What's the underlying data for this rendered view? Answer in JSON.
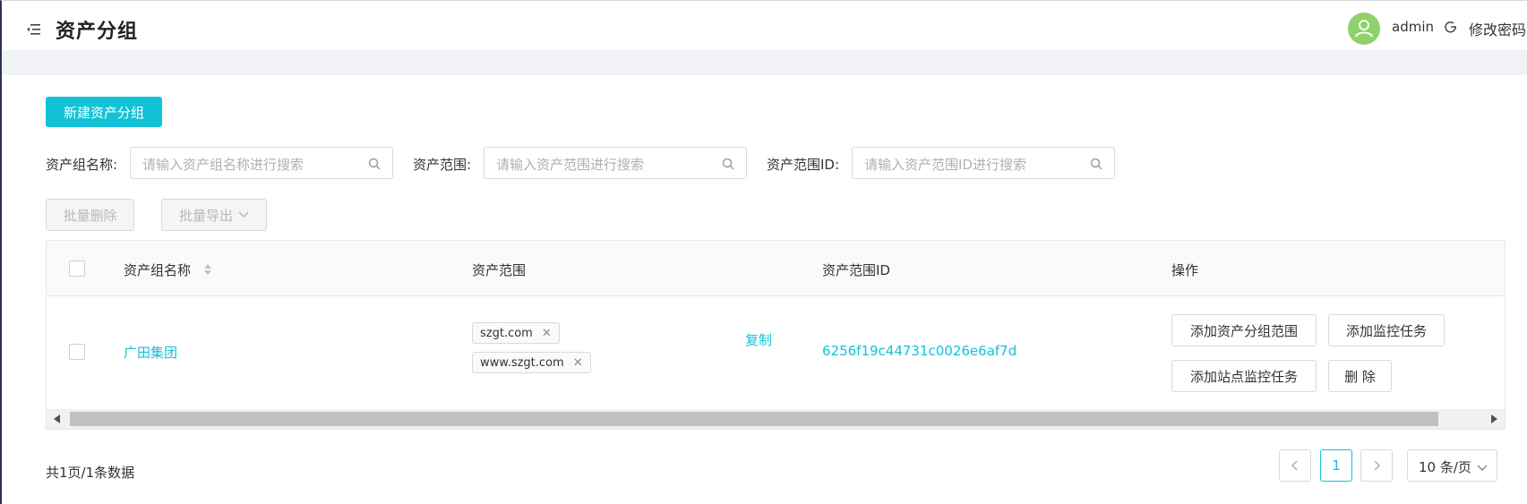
{
  "header": {
    "page_title": "资产分组",
    "username": "admin",
    "change_password": "修改密码"
  },
  "toolbar": {
    "new_group_button": "新建资产分组",
    "batch_delete_button": "批量删除",
    "batch_export_button": "批量导出"
  },
  "filters": [
    {
      "label": "资产组名称:",
      "placeholder": "请输入资产组名称进行搜索"
    },
    {
      "label": "资产范围:",
      "placeholder": "请输入资产范围进行搜索"
    },
    {
      "label": "资产范围ID:",
      "placeholder": "请输入资产范围ID进行搜索"
    }
  ],
  "table": {
    "columns": [
      "资产组名称",
      "资产范围",
      "资产范围ID",
      "操作"
    ],
    "rows": [
      {
        "name": "广田集团",
        "scopes": [
          "szgt.com",
          "www.szgt.com"
        ],
        "copy_label": "复制",
        "scope_id": "6256f19c44731c0026e6af7d",
        "actions": [
          "添加资产分组范围",
          "添加监控任务",
          "添加站点监控任务",
          "删 除"
        ]
      }
    ]
  },
  "pagination": {
    "summary": "共1页/1条数据",
    "current_page": "1",
    "page_size": "10 条/页"
  },
  "colors": {
    "accent": "#13c2d6",
    "avatar": "#8fd16a",
    "background_band": "#f0f2f5"
  },
  "icons": [
    "menu-fold-icon",
    "user-icon",
    "logout-icon",
    "search-icon",
    "chevron-down-icon",
    "sort-icon",
    "close-icon",
    "chevron-left-icon",
    "chevron-right-icon"
  ]
}
